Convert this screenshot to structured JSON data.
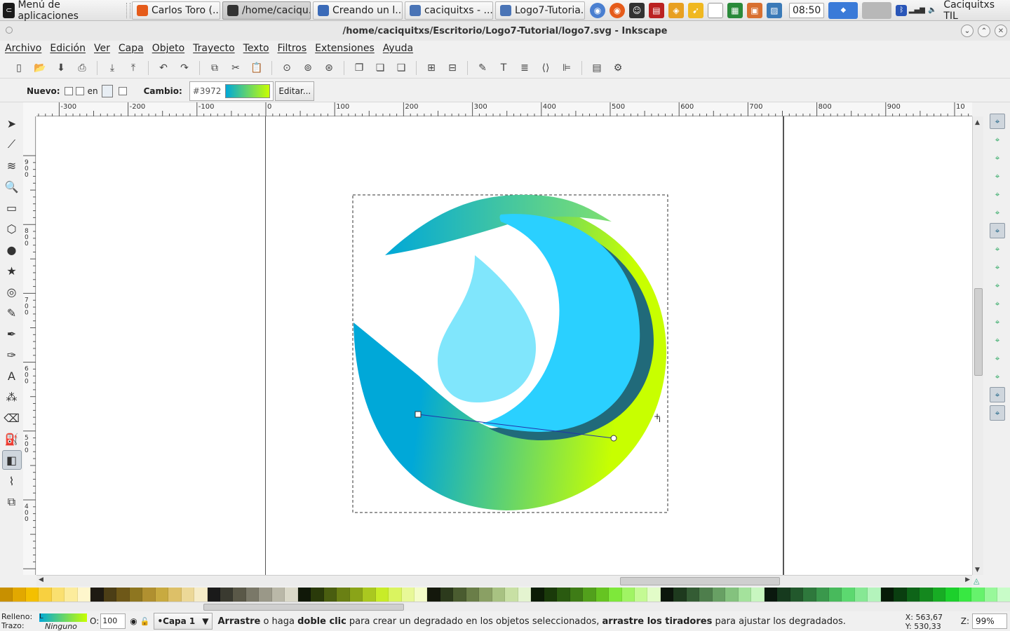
{
  "taskbar": {
    "menu_label": "Menú de aplicaciones",
    "windows": [
      {
        "label": "Carlos Toro (...",
        "icon": "firefox-icon",
        "color": "#e55b1a",
        "width": 126,
        "active": false
      },
      {
        "label": "/home/caciqu...",
        "icon": "inkscape-icon",
        "color": "#333333",
        "width": 126,
        "active": true
      },
      {
        "label": "Creando un l...",
        "icon": "document-icon",
        "color": "#3a6ab8",
        "width": 128,
        "active": false
      },
      {
        "label": "caciquitxs - ...",
        "icon": "folder-icon",
        "color": "#4a74b6",
        "width": 126,
        "active": false
      },
      {
        "label": "Logo7-Tutoria...",
        "icon": "folder-icon",
        "color": "#4a74b6",
        "width": 128,
        "active": false
      }
    ],
    "clock": "08:50",
    "user": "Caciquitxs TIL"
  },
  "window": {
    "title": "/home/caciquitxs/Escritorio/Logo7-Tutorial/logo7.svg - Inkscape"
  },
  "menubar": [
    "Archivo",
    "Edición",
    "Ver",
    "Capa",
    "Objeto",
    "Trayecto",
    "Texto",
    "Filtros",
    "Extensiones",
    "Ayuda"
  ],
  "toolctrl": {
    "new_label": "Nuevo:",
    "on_label": "en",
    "change_label": "Cambio:",
    "gradient_id": "#3972",
    "edit_button": "Editar..."
  },
  "ruler": {
    "h_labels": [
      "-300",
      "-200",
      "-100",
      "0",
      "100",
      "200",
      "300",
      "400",
      "500",
      "600",
      "700",
      "800",
      "900",
      "10"
    ],
    "v_labels": [
      "900",
      "800",
      "700",
      "600",
      "500",
      "400"
    ]
  },
  "status": {
    "fill_label": "Relleno:",
    "fill_value": "L",
    "stroke_label": "Trazo:",
    "stroke_value": "Ninguno",
    "opacity_label": "O:",
    "opacity_value": "100",
    "layer": "•Capa 1",
    "message_parts": [
      {
        "t": "Arrastre",
        "b": true
      },
      {
        "t": " o haga ",
        "b": false
      },
      {
        "t": "doble clic",
        "b": true
      },
      {
        "t": " para crear un degradado en los objetos seleccionados, ",
        "b": false
      },
      {
        "t": "arrastre los tiradores",
        "b": true
      },
      {
        "t": " para ajustar los degradados.",
        "b": false
      }
    ],
    "x_label": "X:",
    "x_value": "563,67",
    "y_label": "Y:",
    "y_value": "530,33",
    "zoom_label": "Z:",
    "zoom_value": "99%"
  },
  "colors": {
    "logo_blue": "#00a8d8",
    "logo_cyan": "#2ad0ff",
    "logo_light": "#80e6fc",
    "logo_dark": "#216a7a",
    "logo_lime": "#c8ff00"
  },
  "palette": [
    "#c89000",
    "#e2a800",
    "#f4c000",
    "#f8d040",
    "#fae070",
    "#fcec9c",
    "#fef6cc",
    "#1e1a12",
    "#4c3e16",
    "#6e5818",
    "#8e7620",
    "#b09030",
    "#c8aa40",
    "#ddc068",
    "#ecd898",
    "#f6ecc8",
    "#1a1a1a",
    "#3a3a30",
    "#5a5848",
    "#7a7868",
    "#9a9888",
    "#bab8a8",
    "#dad8c8",
    "#101808",
    "#2a3a0a",
    "#4a5e10",
    "#6a8014",
    "#8aa418",
    "#aac820",
    "#c8ec28",
    "#daf460",
    "#e8f898",
    "#f4fcc8",
    "#14180c",
    "#2c3a1c",
    "#4a5c30",
    "#6a7e48",
    "#8aa064",
    "#a8c282",
    "#c8e0a4",
    "#e4f4d0",
    "#0c1c06",
    "#1a3a0a",
    "#2a5a10",
    "#3e7c16",
    "#52a01c",
    "#66c422",
    "#7ee83a",
    "#a0f464",
    "#c4fa94",
    "#e2fcc8",
    "#0c160c",
    "#1e3a1e",
    "#345c34",
    "#4e7e4c",
    "#68a064",
    "#84c27e",
    "#a4e29c",
    "#c8f6c0",
    "#0a180e",
    "#163a1e",
    "#22582c",
    "#2e783c",
    "#3a984c",
    "#48ba5c",
    "#5cd870",
    "#86e894",
    "#b4f4bc",
    "#061c08",
    "#0a3e10",
    "#0e6418",
    "#14881e",
    "#18ac24",
    "#1cd02c",
    "#38e842",
    "#66f26c",
    "#98f89a",
    "#c8fcc8"
  ],
  "tools": [
    {
      "name": "select-tool-icon",
      "glyph": "➤"
    },
    {
      "name": "node-tool-icon",
      "glyph": "⟋"
    },
    {
      "name": "tweak-tool-icon",
      "glyph": "≋"
    },
    {
      "name": "zoom-tool-icon",
      "glyph": "🔍"
    },
    {
      "name": "rect-tool-icon",
      "glyph": "▭"
    },
    {
      "name": "box3d-tool-icon",
      "glyph": "⬡"
    },
    {
      "name": "ellipse-tool-icon",
      "glyph": "●"
    },
    {
      "name": "star-tool-icon",
      "glyph": "★"
    },
    {
      "name": "spiral-tool-icon",
      "glyph": "◎"
    },
    {
      "name": "pencil-tool-icon",
      "glyph": "✎"
    },
    {
      "name": "pen-tool-icon",
      "glyph": "✒"
    },
    {
      "name": "calligraphy-tool-icon",
      "glyph": "✑"
    },
    {
      "name": "text-tool-icon",
      "glyph": "A"
    },
    {
      "name": "spray-tool-icon",
      "glyph": "⁂"
    },
    {
      "name": "eraser-tool-icon",
      "glyph": "⌫"
    },
    {
      "name": "bucket-tool-icon",
      "glyph": "⛽"
    },
    {
      "name": "gradient-tool-icon",
      "glyph": "◧"
    },
    {
      "name": "dropper-tool-icon",
      "glyph": "⌇"
    },
    {
      "name": "connector-tool-icon",
      "glyph": "⧉"
    }
  ],
  "commands": [
    {
      "name": "new-doc-icon",
      "glyph": "▯"
    },
    {
      "name": "open-icon",
      "glyph": "📂"
    },
    {
      "name": "save-icon",
      "glyph": "⬇"
    },
    {
      "name": "print-icon",
      "glyph": "⎙"
    },
    {
      "name": "sep",
      "glyph": ""
    },
    {
      "name": "import-icon",
      "glyph": "⤓"
    },
    {
      "name": "export-icon",
      "glyph": "⤒"
    },
    {
      "name": "sep",
      "glyph": ""
    },
    {
      "name": "undo-icon",
      "glyph": "↶"
    },
    {
      "name": "redo-icon",
      "glyph": "↷"
    },
    {
      "name": "sep",
      "glyph": ""
    },
    {
      "name": "copy-icon",
      "glyph": "⧉"
    },
    {
      "name": "cut-icon",
      "glyph": "✂"
    },
    {
      "name": "paste-icon",
      "glyph": "📋"
    },
    {
      "name": "sep",
      "glyph": ""
    },
    {
      "name": "zoom-selection-icon",
      "glyph": "⊙"
    },
    {
      "name": "zoom-drawing-icon",
      "glyph": "⊚"
    },
    {
      "name": "zoom-page-icon",
      "glyph": "⊛"
    },
    {
      "name": "sep",
      "glyph": ""
    },
    {
      "name": "duplicate-icon",
      "glyph": "❐"
    },
    {
      "name": "clone-icon",
      "glyph": "❏"
    },
    {
      "name": "unlink-clone-icon",
      "glyph": "❑"
    },
    {
      "name": "sep",
      "glyph": ""
    },
    {
      "name": "group-icon",
      "glyph": "⊞"
    },
    {
      "name": "ungroup-icon",
      "glyph": "⊟"
    },
    {
      "name": "sep",
      "glyph": ""
    },
    {
      "name": "fill-stroke-icon",
      "glyph": "✎"
    },
    {
      "name": "text-font-icon",
      "glyph": "T"
    },
    {
      "name": "layers-icon",
      "glyph": "≣"
    },
    {
      "name": "xml-editor-icon",
      "glyph": "⟨⟩"
    },
    {
      "name": "align-icon",
      "glyph": "⊫"
    },
    {
      "name": "sep",
      "glyph": ""
    },
    {
      "name": "doc-props-icon",
      "glyph": "▤"
    },
    {
      "name": "preferences-icon",
      "glyph": "⚙"
    }
  ],
  "snaps": [
    {
      "name": "snap-enable-icon",
      "on": true
    },
    {
      "name": "snap-bbox-icon",
      "on": false
    },
    {
      "name": "snap-bbox-edge-icon",
      "on": false
    },
    {
      "name": "snap-bbox-corner-icon",
      "on": false
    },
    {
      "name": "snap-bbox-edge-mid-icon",
      "on": false
    },
    {
      "name": "snap-bbox-center-icon",
      "on": false
    },
    {
      "name": "snap-nodes-icon",
      "on": true
    },
    {
      "name": "snap-paths-icon",
      "on": false
    },
    {
      "name": "snap-intersection-icon",
      "on": false
    },
    {
      "name": "snap-cusp-icon",
      "on": false
    },
    {
      "name": "snap-smooth-icon",
      "on": false
    },
    {
      "name": "snap-midpoint-icon",
      "on": false
    },
    {
      "name": "snap-object-center-icon",
      "on": false
    },
    {
      "name": "snap-rotation-center-icon",
      "on": false
    },
    {
      "name": "snap-page-icon",
      "on": false
    },
    {
      "name": "snap-grid-icon",
      "on": true
    },
    {
      "name": "snap-guide-icon",
      "on": true
    }
  ]
}
